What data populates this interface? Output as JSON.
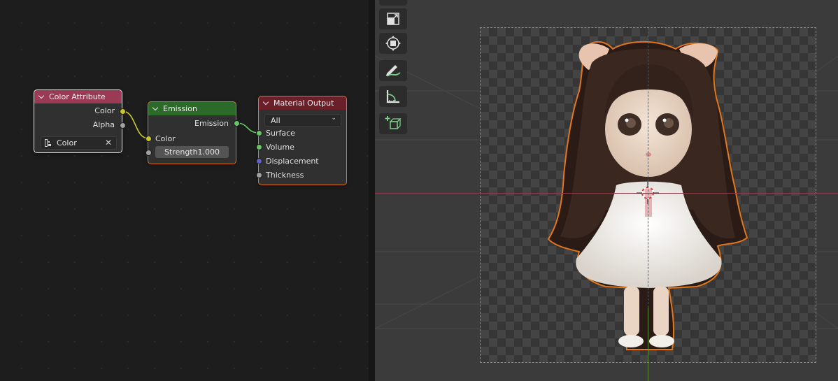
{
  "node_editor": {
    "nodes": {
      "color_attribute": {
        "title": "Color Attribute",
        "header_color": "#9b3a55",
        "outputs": [
          "Color",
          "Alpha"
        ],
        "attribute_field": {
          "value": "Color",
          "clear_icon": "x-icon",
          "type_icon": "color-attribute-icon"
        }
      },
      "emission": {
        "title": "Emission",
        "header_color": "#2c6a2a",
        "output": "Emission",
        "inputs": {
          "color_label": "Color",
          "strength_label": "Strength",
          "strength_value": "1.000"
        }
      },
      "material_output": {
        "title": "Material Output",
        "header_color": "#6b2029",
        "target": "All",
        "inputs": [
          "Surface",
          "Volume",
          "Displacement",
          "Thickness"
        ]
      }
    },
    "socket_colors": {
      "color": "#c7c729",
      "float": "#a1a1a1",
      "shader": "#63c763",
      "vector": "#6363c7"
    }
  },
  "viewport": {
    "toolbar_icons": [
      "orbit-icon",
      "scale-icon",
      "transform-icon",
      "annotate-icon",
      "measure-icon",
      "add-cube-icon"
    ],
    "selection_outline_color": "#e2761b",
    "x_axis_color": "#8a3a48",
    "y_axis_color": "#5f8f3a"
  }
}
